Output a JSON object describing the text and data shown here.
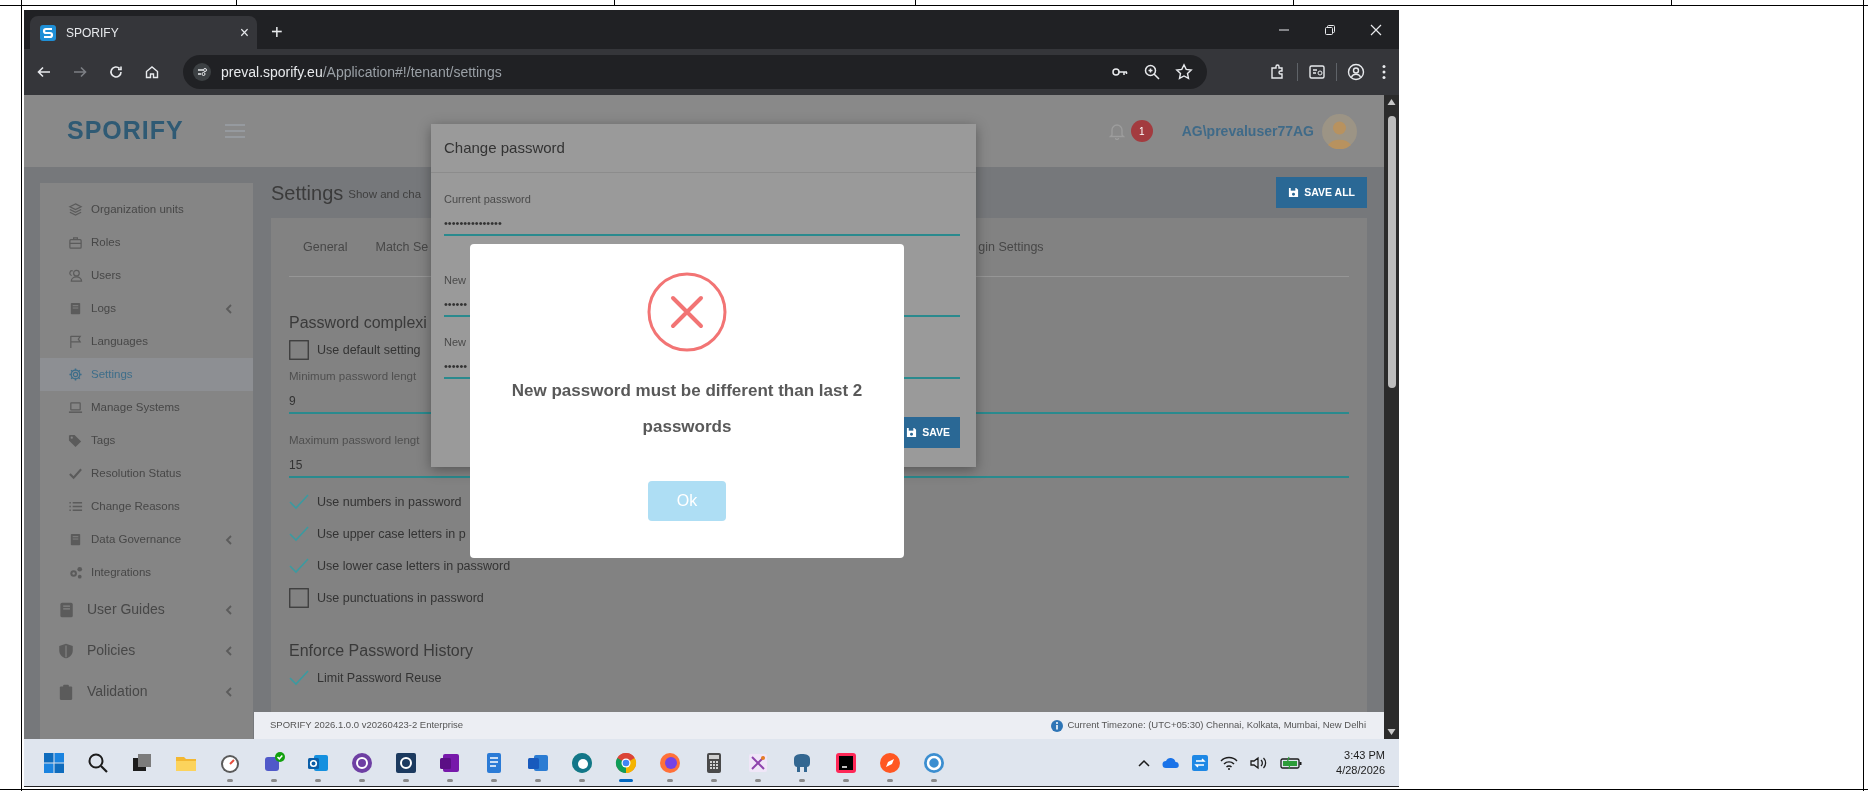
{
  "browser": {
    "tab": {
      "title": "SPORIFY",
      "close": "×"
    },
    "new_tab": "+",
    "address": {
      "host": "preval.sporify.eu",
      "path": "/Application#!/tenant/settings"
    }
  },
  "header": {
    "logo": "SPORIFY",
    "notification_count": "1",
    "user": "AG\\prevaluser77AG"
  },
  "sidebar": {
    "items": [
      {
        "kind": "sub",
        "label": "Organization units",
        "selected": false,
        "has_submenu": false
      },
      {
        "kind": "sub",
        "label": "Roles",
        "selected": false,
        "has_submenu": false
      },
      {
        "kind": "sub",
        "label": "Users",
        "selected": false,
        "has_submenu": false
      },
      {
        "kind": "sub",
        "label": "Logs",
        "selected": false,
        "has_submenu": true
      },
      {
        "kind": "sub",
        "label": "Languages",
        "selected": false,
        "has_submenu": false
      },
      {
        "kind": "sub",
        "label": "Settings",
        "selected": true,
        "has_submenu": false
      },
      {
        "kind": "sub",
        "label": "Manage Systems",
        "selected": false,
        "has_submenu": false
      },
      {
        "kind": "sub",
        "label": "Tags",
        "selected": false,
        "has_submenu": false
      },
      {
        "kind": "sub",
        "label": "Resolution Status",
        "selected": false,
        "has_submenu": false
      },
      {
        "kind": "sub",
        "label": "Change Reasons",
        "selected": false,
        "has_submenu": false
      },
      {
        "kind": "sub",
        "label": "Data Governance",
        "selected": false,
        "has_submenu": true
      },
      {
        "kind": "sub",
        "label": "Integrations",
        "selected": false,
        "has_submenu": false
      },
      {
        "kind": "main",
        "label": "User Guides",
        "selected": false,
        "has_submenu": true
      },
      {
        "kind": "main",
        "label": "Policies",
        "selected": false,
        "has_submenu": true
      },
      {
        "kind": "main",
        "label": "Validation",
        "selected": false,
        "has_submenu": true
      }
    ]
  },
  "settings": {
    "title": "Settings",
    "subtitle": "Show and cha",
    "save_all": "SAVE ALL",
    "tabs": [
      {
        "label": "General",
        "selected": false
      },
      {
        "label": "Match Se",
        "selected": false
      },
      {
        "label": "gin Settings",
        "selected": false
      }
    ],
    "password_complexity": {
      "heading": "Password complexi",
      "default_option": {
        "label": "Use default setting",
        "checked": false
      },
      "fields": [
        {
          "label": "Minimum password lengt",
          "value": "9"
        },
        {
          "label": "Maximum password lengt",
          "value": "15"
        }
      ],
      "rules": [
        {
          "label": "Use numbers in password",
          "checked": true
        },
        {
          "label": "Use upper case letters in p",
          "checked": true
        },
        {
          "label": "Use lower case letters in password",
          "checked": true
        },
        {
          "label": "Use punctuations in password",
          "checked": false
        }
      ]
    },
    "password_history": {
      "heading": "Enforce Password History",
      "rules": [
        {
          "label": "Limit Password Reuse",
          "checked": true
        }
      ]
    }
  },
  "footer": {
    "version": "SPORIFY 2026.1.0.0 v20260423-2 Enterprise",
    "timezone": "Current Timezone: (UTC+05:30) Chennai, Kolkata, Mumbai, New Delhi"
  },
  "change_password_dialog": {
    "title": "Change password",
    "fields": [
      {
        "label": "Current password",
        "value": "•••••••••••••••"
      },
      {
        "label": "New",
        "value": "••••••"
      },
      {
        "label": "New",
        "value": "••••••"
      }
    ],
    "save": "SAVE"
  },
  "alert": {
    "message": "New password must be different than last 2 passwords",
    "button": "Ok"
  },
  "taskbar": {
    "time": "3:43 PM",
    "date": "4/28/2026"
  }
}
